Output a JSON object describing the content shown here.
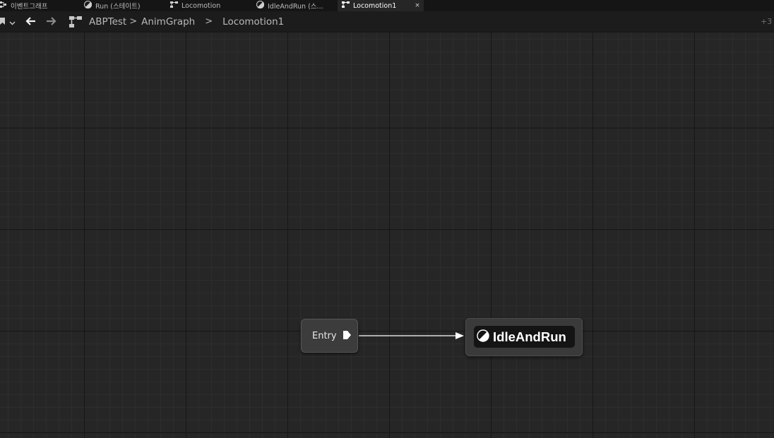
{
  "tabs": [
    {
      "label": "이벤트그래프",
      "icon": "event-graph-icon",
      "active": false
    },
    {
      "label": "Run (스테이트)",
      "icon": "state-icon",
      "active": false
    },
    {
      "label": "Locomotion",
      "icon": "state-machine-icon",
      "active": false
    },
    {
      "label": "IdleAndRun (스...",
      "icon": "state-icon",
      "active": false
    },
    {
      "label": "Locomotion1",
      "icon": "state-machine-icon",
      "active": true,
      "close": "×"
    }
  ],
  "toolbar": {
    "breadcrumb": [
      {
        "label": "ABPTest"
      },
      {
        "label": "AnimGraph"
      },
      {
        "label": "Locomotion1"
      }
    ],
    "separator": ">",
    "overflow_count": "+3"
  },
  "graph": {
    "entry_node": {
      "label": "Entry"
    },
    "state_node": {
      "label": "IdleAndRun"
    }
  },
  "colors": {
    "canvas": "#262626",
    "tabbar": "#151515",
    "toolbar": "#1c1c1c",
    "node": "#3c3c3c",
    "wire": "#ffffff"
  }
}
